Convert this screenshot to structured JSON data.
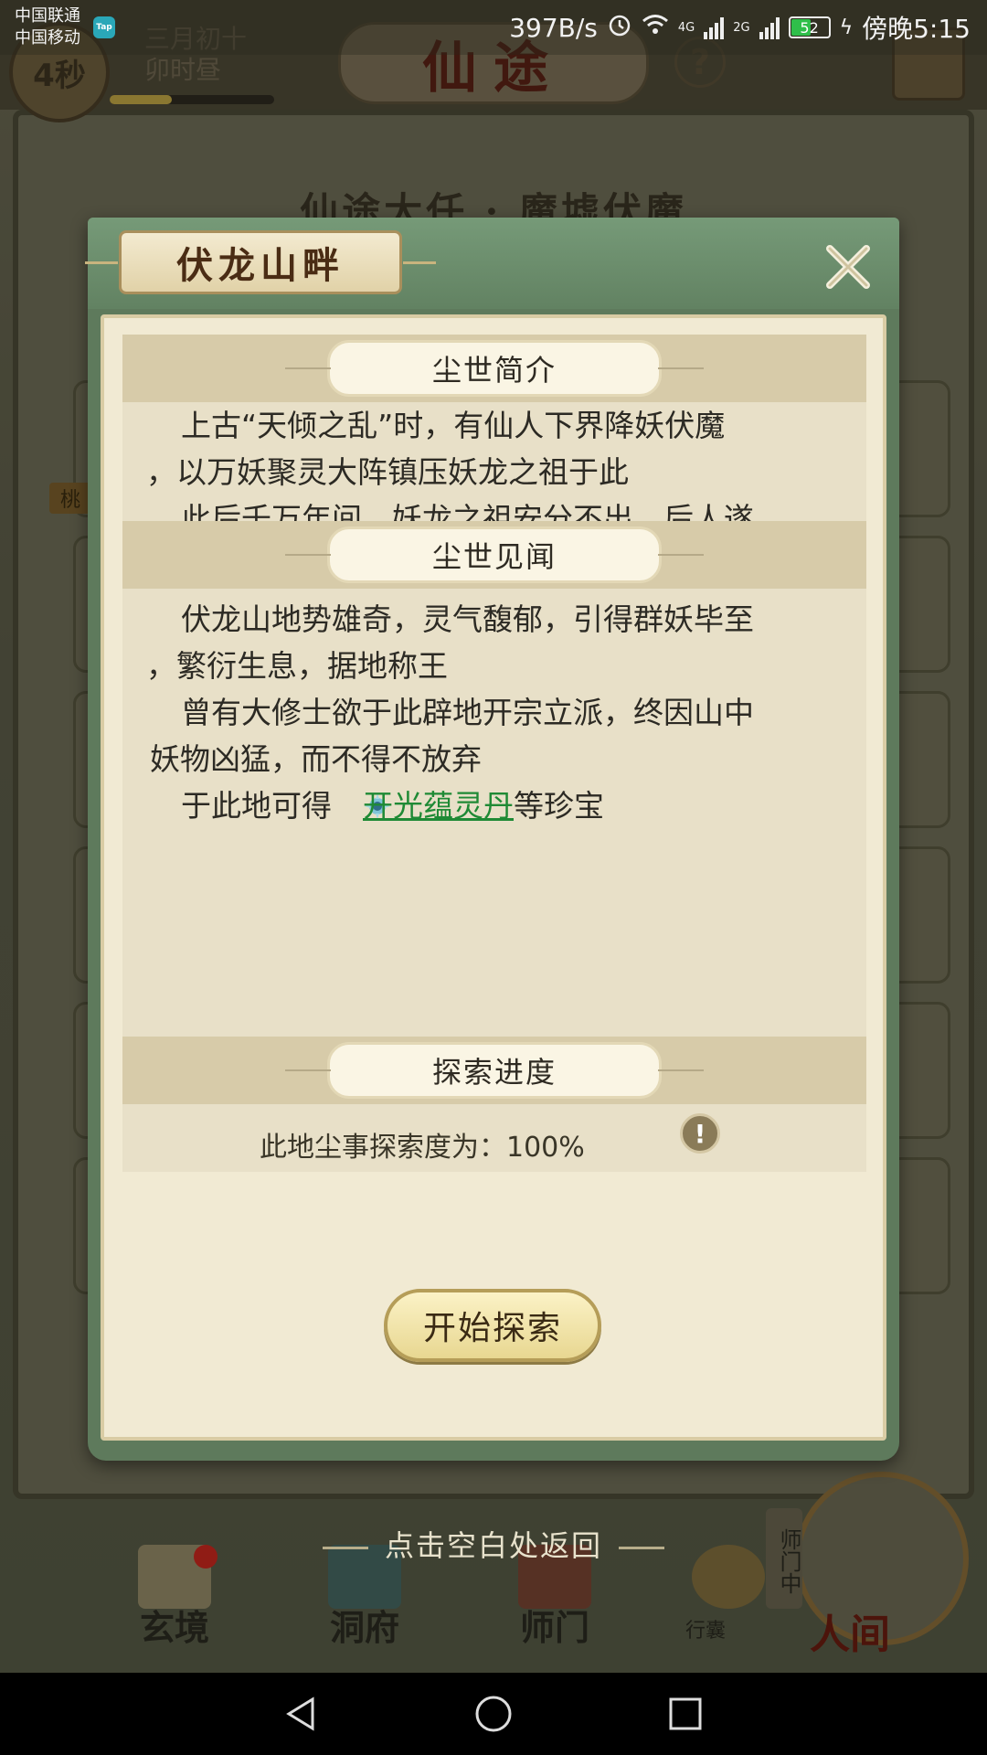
{
  "status_bar": {
    "carrier_1": "中国联通",
    "carrier_2": "中国移动",
    "tap_badge": "Tap",
    "net_speed": "397B/s",
    "network_1": "4G",
    "network_2": "2G",
    "battery": "52",
    "time": "傍晚5:15",
    "battery_color": "#2fbf4a"
  },
  "game_hud": {
    "countdown": "4秒",
    "lunar_date": "三月初十",
    "time_of_day": "卯时昼",
    "title": "仙途",
    "help": "?",
    "bar_level": 0.38
  },
  "background": {
    "heading": "仙途大任 · 魔墟伏魔",
    "side_tag": "桃"
  },
  "modal": {
    "title": "伏龙山畔",
    "sections": {
      "intro": {
        "label": "尘世简介",
        "line_1": "上古“天倾之乱”时，有仙人下界降妖伏魔",
        "line_2": "，以万妖聚灵大阵镇压妖龙之祖于此",
        "line_3": "此后千万年间，妖龙之祖安分不出，后人遂"
      },
      "news": {
        "label": "尘世见闻",
        "line_1": "伏龙山地势雄奇，灵气馥郁，引得群妖毕至",
        "line_2": "，繁衍生息，据地称王",
        "line_3": "曾有大修士欲于此辟地开宗立派，终因山中",
        "line_4": "妖物凶猛，而不得不放弃",
        "line_5_prefix": "于此地可得",
        "line_5_item": "开光蕴灵丹",
        "line_5_suffix": "等珍宝"
      },
      "progress": {
        "label": "探索进度",
        "text": "此地尘事探索度为：100%",
        "alert": "!"
      }
    },
    "start_button": "开始探索",
    "accent_green": "#1f8a35"
  },
  "bottom": {
    "return_hint": "点击空白处返回",
    "nav": {
      "xuanjing": "玄境",
      "dongfu": "洞府",
      "shimen": "师门",
      "bag": "行囊",
      "sect_tag": "师门中",
      "human": "人间"
    }
  }
}
